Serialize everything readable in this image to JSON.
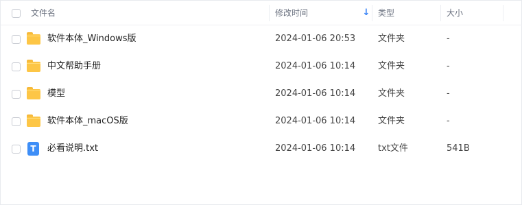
{
  "columns": {
    "name": "文件名",
    "modified": "修改时间",
    "type": "类型",
    "size": "大小"
  },
  "sort": {
    "column": "modified",
    "direction": "descending",
    "icon": "arrow-down-icon"
  },
  "files": [
    {
      "name": "软件本体_Windows版",
      "modified": "2024-01-06 20:53",
      "type": "文件夹",
      "size": "-",
      "icon": "folder-icon"
    },
    {
      "name": "中文帮助手册",
      "modified": "2024-01-06 10:14",
      "type": "文件夹",
      "size": "-",
      "icon": "folder-icon"
    },
    {
      "name": "模型",
      "modified": "2024-01-06 10:14",
      "type": "文件夹",
      "size": "-",
      "icon": "folder-icon"
    },
    {
      "name": "软件本体_macOS版",
      "modified": "2024-01-06 10:14",
      "type": "文件夹",
      "size": "-",
      "icon": "folder-icon"
    },
    {
      "name": "必看说明.txt",
      "modified": "2024-01-06 10:14",
      "type": "txt文件",
      "size": "541B",
      "icon": "text-file-icon",
      "icon_letter": "T"
    }
  ],
  "colors": {
    "accent": "#2f7df6",
    "folder": "#fdc646",
    "txt_icon": "#3e8ef7"
  }
}
